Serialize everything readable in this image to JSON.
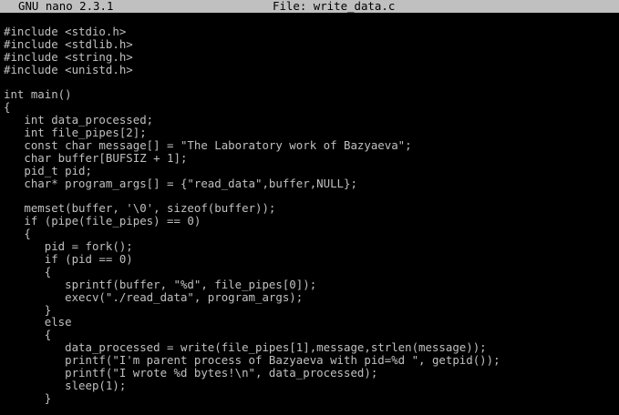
{
  "titlebar": {
    "app": "GNU nano 2.3.1",
    "file": "File: write_data.c"
  },
  "editor": {
    "lines": [
      "#include <stdio.h>",
      "#include <stdlib.h>",
      "#include <string.h>",
      "#include <unistd.h>",
      "",
      "int main()",
      "{",
      "   int data_processed;",
      "   int file_pipes[2];",
      "   const char message[] = \"The Laboratory work of Bazyaeva\";",
      "   char buffer[BUFSIZ + 1];",
      "   pid_t pid;",
      "   char* program_args[] = {\"read_data\",buffer,NULL};",
      "",
      "   memset(buffer, '\\0', sizeof(buffer));",
      "   if (pipe(file_pipes) == 0)",
      "   {",
      "      pid = fork();",
      "      if (pid == 0)",
      "      {",
      "         sprintf(buffer, \"%d\", file_pipes[0]);",
      "         execv(\"./read_data\", program_args);",
      "      }",
      "      else",
      "      {",
      "         data_processed = write(file_pipes[1],message,strlen(message));",
      "         printf(\"I'm parent process of Bazyaeva with pid=%d \", getpid());",
      "         printf(\"I wrote %d bytes!\\n\", data_processed);",
      "         sleep(1);",
      "      }"
    ]
  }
}
